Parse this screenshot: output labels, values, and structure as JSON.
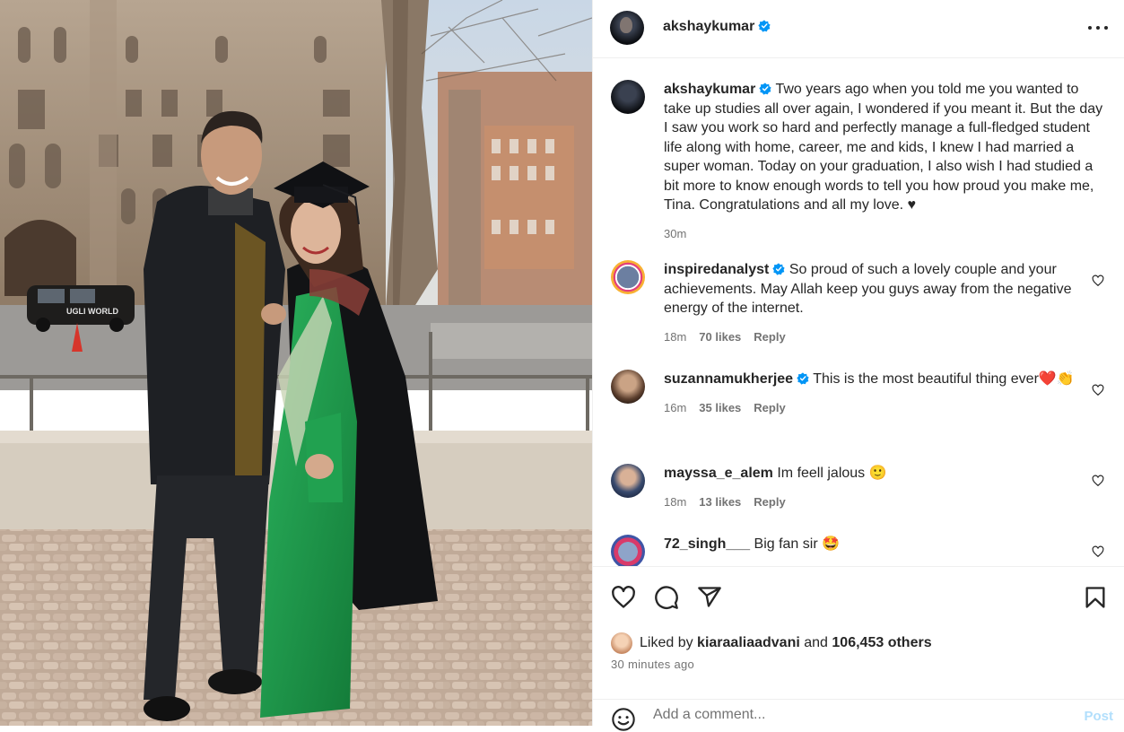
{
  "post": {
    "image_alt": "Couple standing on a cobblestone street in front of gothic buildings; woman in graduation cap and gown over a green saree",
    "taxi_sign": "UGLI WORLD"
  },
  "header": {
    "username": "akshaykumar",
    "verified_icon": "verified-badge-icon",
    "more_icon": "more-options-icon"
  },
  "caption": {
    "username": "akshaykumar",
    "text": "Two years ago when you told me you wanted to take up studies all over again, I wondered if you meant it. But the day I saw you work so hard and perfectly manage a full-fledged student life along with home, career, me and kids, I knew I had married a super woman. Today on your graduation, I also wish I had studied a bit more to know enough words to tell you how proud you make me, Tina. Congratulations and all my love. ♥",
    "time": "30m"
  },
  "comments": [
    {
      "username": "inspiredanalyst",
      "text": "So proud of such a lovely couple and your achievements. May Allah keep you guys away from the negative energy of the internet.",
      "time": "18m",
      "likes": "70 likes",
      "reply": "Reply"
    },
    {
      "username": "suzannamukherjee",
      "text": "This is the most beautiful thing ever❤️👏",
      "time": "16m",
      "likes": "35 likes",
      "reply": "Reply"
    },
    {
      "username": "mayssa_e_alem",
      "text": "Im feell jalous 🙂",
      "time": "18m",
      "likes": "13 likes",
      "reply": "Reply"
    },
    {
      "username": "72_singh___",
      "text": "Big fan sir 🤩"
    }
  ],
  "actions": {
    "like_icon": "heart-icon",
    "comment_icon": "comment-icon",
    "share_icon": "share-icon",
    "save_icon": "bookmark-icon"
  },
  "likes": {
    "prefix": "Liked by",
    "liker": "kiaraaliaadvani",
    "middle": "and",
    "others": "106,453 others"
  },
  "timestamp": "30 minutes ago",
  "add_comment": {
    "placeholder": "Add a comment...",
    "post_label": "Post",
    "emoji_icon": "emoji-icon"
  },
  "colors": {
    "text": "#262626",
    "secondary": "#737373",
    "verified": "#0095f6",
    "post_disabled": "#b2dffc",
    "saree_green": "#1f9a4a"
  }
}
